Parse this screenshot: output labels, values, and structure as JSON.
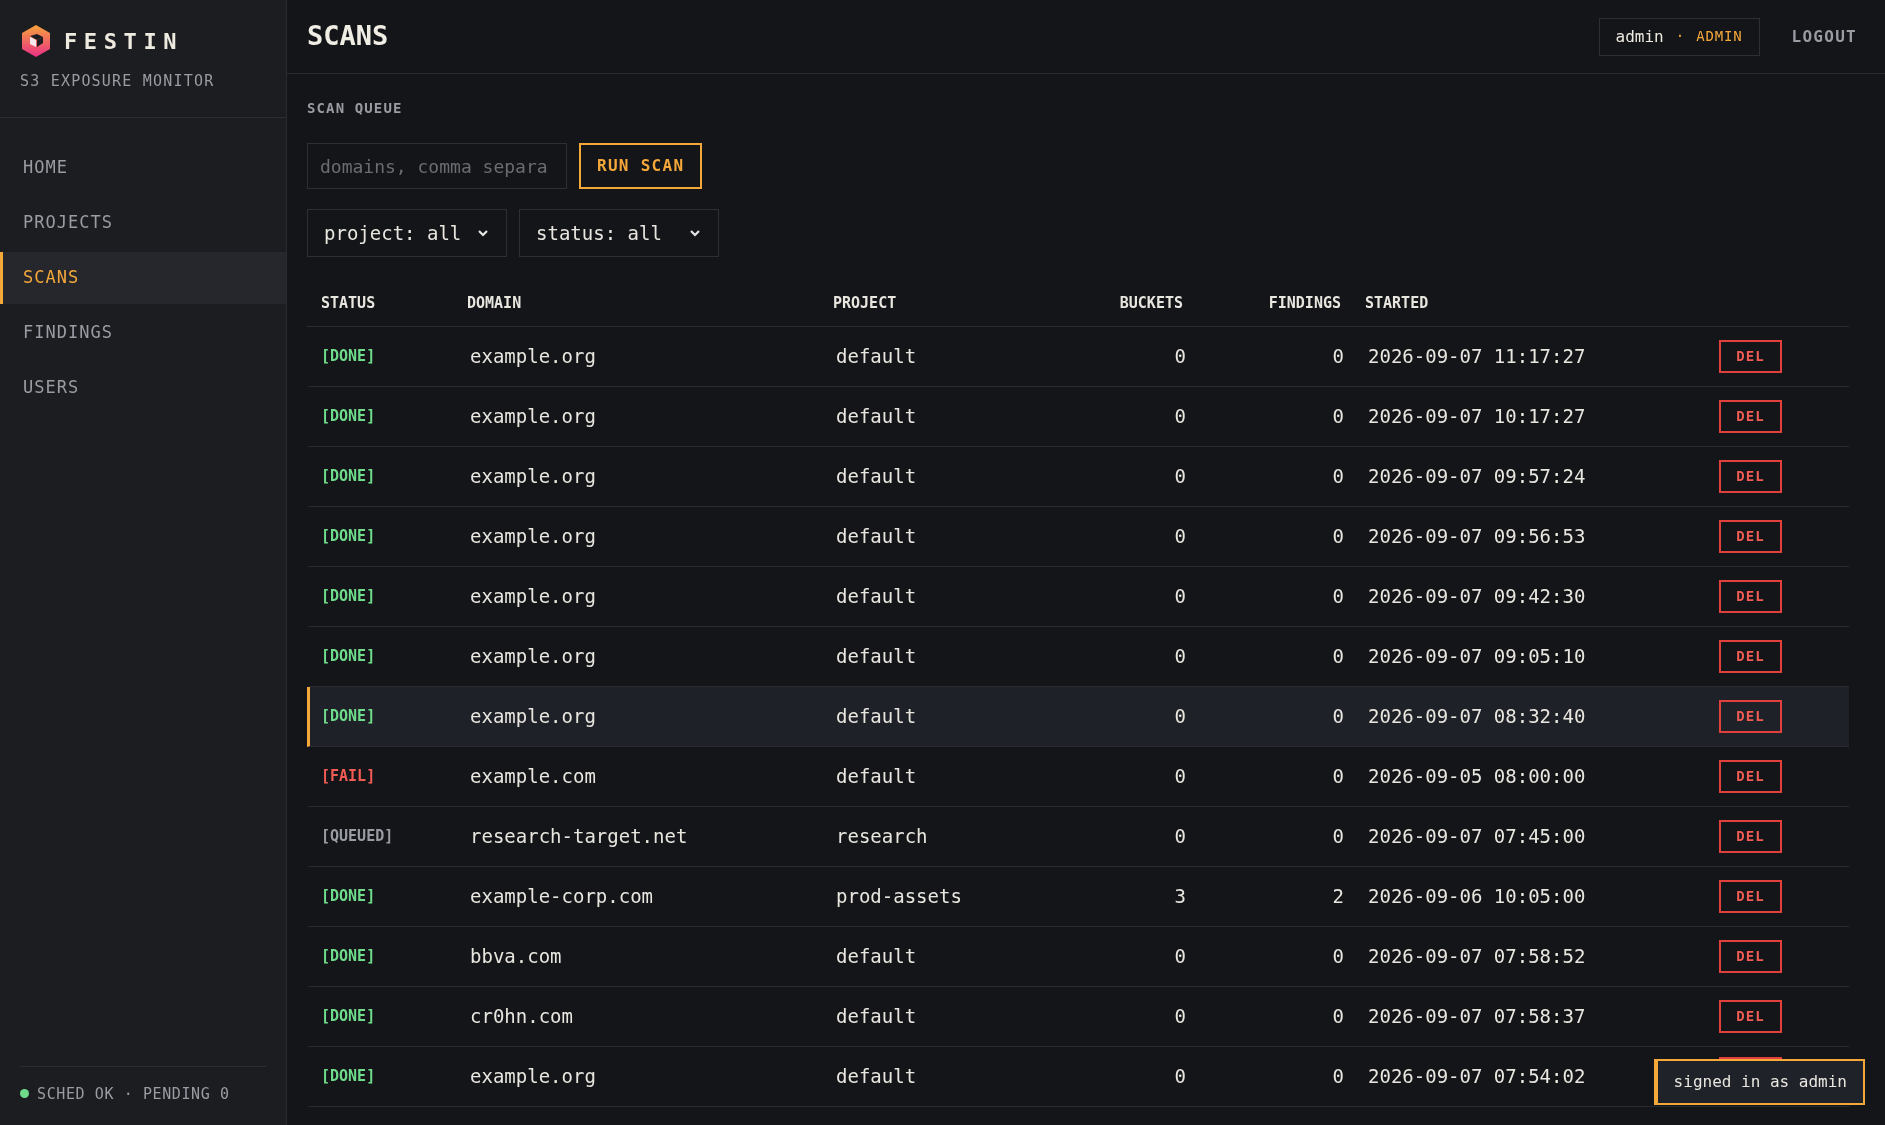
{
  "brand": {
    "name": "FESTIN",
    "subtitle": "S3 EXPOSURE MONITOR"
  },
  "nav": [
    {
      "label": "HOME",
      "selected": false
    },
    {
      "label": "PROJECTS",
      "selected": false
    },
    {
      "label": "SCANS",
      "selected": true
    },
    {
      "label": "FINDINGS",
      "selected": false
    },
    {
      "label": "USERS",
      "selected": false
    }
  ],
  "scheduler": {
    "text": "SCHED OK · PENDING 0",
    "color": "#6fdc8c"
  },
  "header": {
    "title": "SCANS",
    "user": "admin",
    "separator": "·",
    "role": "ADMIN",
    "logout": "LOGOUT"
  },
  "queue": {
    "heading": "SCAN QUEUE",
    "placeholder": "domains, comma separa",
    "run": "RUN SCAN",
    "project_filter": "project: all",
    "status_filter": "status: all"
  },
  "table": {
    "columns": [
      "STATUS",
      "DOMAIN",
      "PROJECT",
      "BUCKETS",
      "FINDINGS",
      "STARTED"
    ],
    "rows": [
      {
        "status": "[DONE]",
        "kind": "done",
        "domain": "example.org",
        "project": "default",
        "buckets": "0",
        "findings": "0",
        "started": "2026-09-07 11:17:27",
        "action": "DEL",
        "selected": false
      },
      {
        "status": "[DONE]",
        "kind": "done",
        "domain": "example.org",
        "project": "default",
        "buckets": "0",
        "findings": "0",
        "started": "2026-09-07 10:17:27",
        "action": "DEL",
        "selected": false
      },
      {
        "status": "[DONE]",
        "kind": "done",
        "domain": "example.org",
        "project": "default",
        "buckets": "0",
        "findings": "0",
        "started": "2026-09-07 09:57:24",
        "action": "DEL",
        "selected": false
      },
      {
        "status": "[DONE]",
        "kind": "done",
        "domain": "example.org",
        "project": "default",
        "buckets": "0",
        "findings": "0",
        "started": "2026-09-07 09:56:53",
        "action": "DEL",
        "selected": false
      },
      {
        "status": "[DONE]",
        "kind": "done",
        "domain": "example.org",
        "project": "default",
        "buckets": "0",
        "findings": "0",
        "started": "2026-09-07 09:42:30",
        "action": "DEL",
        "selected": false
      },
      {
        "status": "[DONE]",
        "kind": "done",
        "domain": "example.org",
        "project": "default",
        "buckets": "0",
        "findings": "0",
        "started": "2026-09-07 09:05:10",
        "action": "DEL",
        "selected": false
      },
      {
        "status": "[DONE]",
        "kind": "done",
        "domain": "example.org",
        "project": "default",
        "buckets": "0",
        "findings": "0",
        "started": "2026-09-07 08:32:40",
        "action": "DEL",
        "selected": true
      },
      {
        "status": "[FAIL]",
        "kind": "fail",
        "domain": "example.com",
        "project": "default",
        "buckets": "0",
        "findings": "0",
        "started": "2026-09-05 08:00:00",
        "action": "DEL",
        "selected": false
      },
      {
        "status": "[QUEUED]",
        "kind": "queued",
        "domain": "research-target.net",
        "project": "research",
        "buckets": "0",
        "findings": "0",
        "started": "2026-09-07 07:45:00",
        "action": "DEL",
        "selected": false
      },
      {
        "status": "[DONE]",
        "kind": "done",
        "domain": "example-corp.com",
        "project": "prod-assets",
        "buckets": "3",
        "findings": "2",
        "started": "2026-09-06 10:05:00",
        "action": "DEL",
        "selected": false
      },
      {
        "status": "[DONE]",
        "kind": "done",
        "domain": "bbva.com",
        "project": "default",
        "buckets": "0",
        "findings": "0",
        "started": "2026-09-07 07:58:52",
        "action": "DEL",
        "selected": false
      },
      {
        "status": "[DONE]",
        "kind": "done",
        "domain": "cr0hn.com",
        "project": "default",
        "buckets": "0",
        "findings": "0",
        "started": "2026-09-07 07:58:37",
        "action": "DEL",
        "selected": false
      },
      {
        "status": "[DONE]",
        "kind": "done",
        "domain": "example.org",
        "project": "default",
        "buckets": "0",
        "findings": "0",
        "started": "2026-09-07 07:54:02",
        "selected": false
      }
    ]
  },
  "toast": {
    "text": "signed in as admin"
  }
}
